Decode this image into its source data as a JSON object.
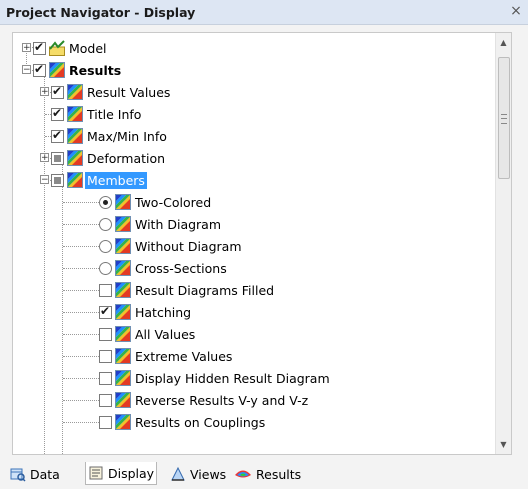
{
  "window": {
    "title": "Project Navigator - Display",
    "close_glyph": "×"
  },
  "tree": {
    "items": [
      {
        "label": "Model",
        "checkbox": "checked",
        "icon": "model-icon"
      },
      {
        "label": "Results",
        "checkbox": "checked",
        "icon": "results-icon"
      },
      {
        "label": "Result Values",
        "checkbox": "checked",
        "icon": "results-icon"
      },
      {
        "label": "Title Info",
        "checkbox": "checked",
        "icon": "results-icon"
      },
      {
        "label": "Max/Min Info",
        "checkbox": "checked",
        "icon": "results-icon"
      },
      {
        "label": "Deformation",
        "checkbox": "partial",
        "icon": "results-icon"
      },
      {
        "label": "Members",
        "checkbox": "partial",
        "icon": "results-icon",
        "selected": true
      },
      {
        "label": "Two-Colored",
        "radio": "on",
        "icon": "results-icon"
      },
      {
        "label": "With Diagram",
        "radio": "off",
        "icon": "results-icon"
      },
      {
        "label": "Without Diagram",
        "radio": "off",
        "icon": "results-icon"
      },
      {
        "label": "Cross-Sections",
        "radio": "off",
        "icon": "results-icon"
      },
      {
        "label": "Result Diagrams Filled",
        "checkbox": "unchecked",
        "icon": "results-icon"
      },
      {
        "label": "Hatching",
        "checkbox": "checked",
        "icon": "results-icon"
      },
      {
        "label": "All Values",
        "checkbox": "unchecked",
        "icon": "results-icon"
      },
      {
        "label": "Extreme Values",
        "checkbox": "unchecked",
        "icon": "results-icon"
      },
      {
        "label": "Display Hidden Result Diagram",
        "checkbox": "unchecked",
        "icon": "results-icon"
      },
      {
        "label": "Reverse Results V-y and V-z",
        "checkbox": "unchecked",
        "icon": "results-icon"
      },
      {
        "label": "Results on Couplings",
        "checkbox": "unchecked",
        "icon": "results-icon"
      }
    ]
  },
  "tabs": [
    {
      "label": "Data",
      "icon": "data-icon"
    },
    {
      "label": "Display",
      "icon": "display-icon",
      "active": true
    },
    {
      "label": "Views",
      "icon": "views-icon"
    },
    {
      "label": "Results",
      "icon": "results-tab-icon"
    }
  ]
}
